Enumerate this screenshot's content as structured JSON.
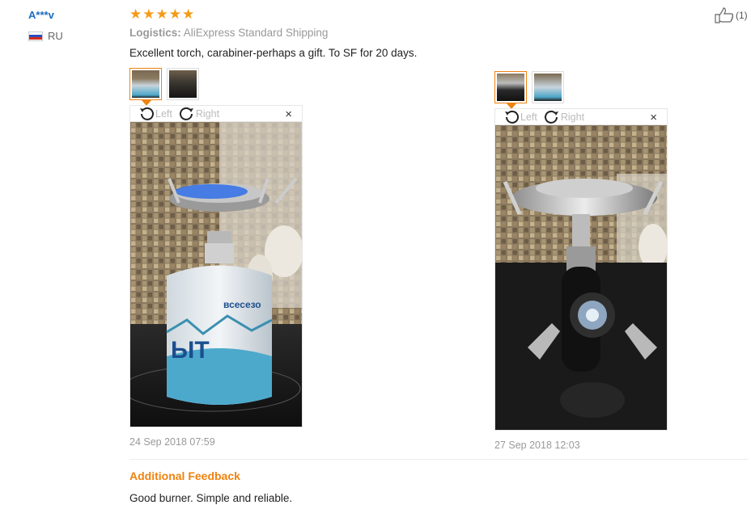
{
  "review": {
    "user": "A***v",
    "country": "RU",
    "rating": 5,
    "logistics_label": "Logistics:",
    "logistics_value": "AliExpress Standard Shipping",
    "text": "Excellent torch, carabiner-perhaps a gift. To SF for 20 days.",
    "helpful_count": "(1)"
  },
  "viewer": {
    "left_label": "Left",
    "right_label": "Right",
    "close_symbol": "×"
  },
  "photos": [
    {
      "date": "24 Sep 2018 07:59"
    },
    {
      "date": "27 Sep 2018 12:03"
    }
  ],
  "additional": {
    "title": "Additional Feedback",
    "text": "Good burner. Simple and reliable."
  },
  "colors": {
    "accent": "#f0820f",
    "username": "#1a6bbf",
    "star": "#f59a14"
  }
}
